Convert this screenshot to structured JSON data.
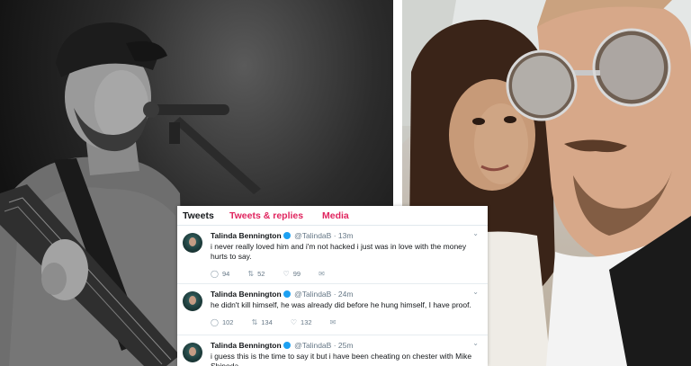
{
  "tabs": {
    "tweets": "Tweets",
    "tweets_replies": "Tweets & replies",
    "media": "Media"
  },
  "tweets": [
    {
      "name": "Talinda Bennington",
      "handle": "@TalindaB",
      "time": "· 13m",
      "text": "i never really loved him and i'm not hacked i just was in love with the money hurts to say.",
      "replies": "94",
      "retweets": "52",
      "likes": "99"
    },
    {
      "name": "Talinda Bennington",
      "handle": "@TalindaB",
      "time": "· 24m",
      "text": "he didn't kill himself, he was already did before he hung himself, I have proof.",
      "replies": "102",
      "retweets": "134",
      "likes": "132"
    },
    {
      "name": "Talinda Bennington",
      "handle": "@TalindaB",
      "time": "· 25m",
      "text": "i guess this is the time to say it but i have been cheating on chester with Mike Shinoda ..."
    }
  ],
  "icons": {
    "reply": "reply-icon",
    "retweet": "retweet-icon",
    "like": "heart-icon",
    "dm": "envelope-icon",
    "verified": "verified-badge-icon",
    "caret": "chevron-down-icon"
  },
  "colors": {
    "accent": "#e0245e",
    "verified": "#1da1f2",
    "muted": "#657786"
  }
}
